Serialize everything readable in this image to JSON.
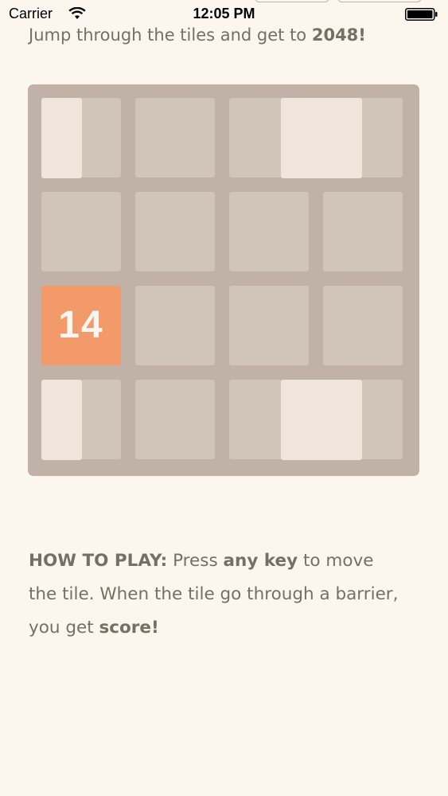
{
  "status_bar": {
    "carrier": "Carrier",
    "time": "12:05 PM",
    "icons": [
      "wifi-icon",
      "battery-icon"
    ]
  },
  "intro": {
    "prefix": "Jump through the tiles and get to ",
    "goal": "2048!"
  },
  "board": {
    "rows": 4,
    "columns": 4,
    "tile": {
      "value": "14",
      "row": 3,
      "column": 1,
      "color": "#f2935e"
    },
    "barrier_rows": [
      1,
      4
    ],
    "colors": {
      "board": "#bbada0",
      "cell": "#cdc1b4",
      "barrier": "#eee4da"
    }
  },
  "how_to_play": {
    "label": "HOW TO PLAY:",
    "text1": " Press ",
    "key_phrase": "any key",
    "text2": " to move the tile. When the tile go through a barrier, you get ",
    "score_word": "score!"
  }
}
